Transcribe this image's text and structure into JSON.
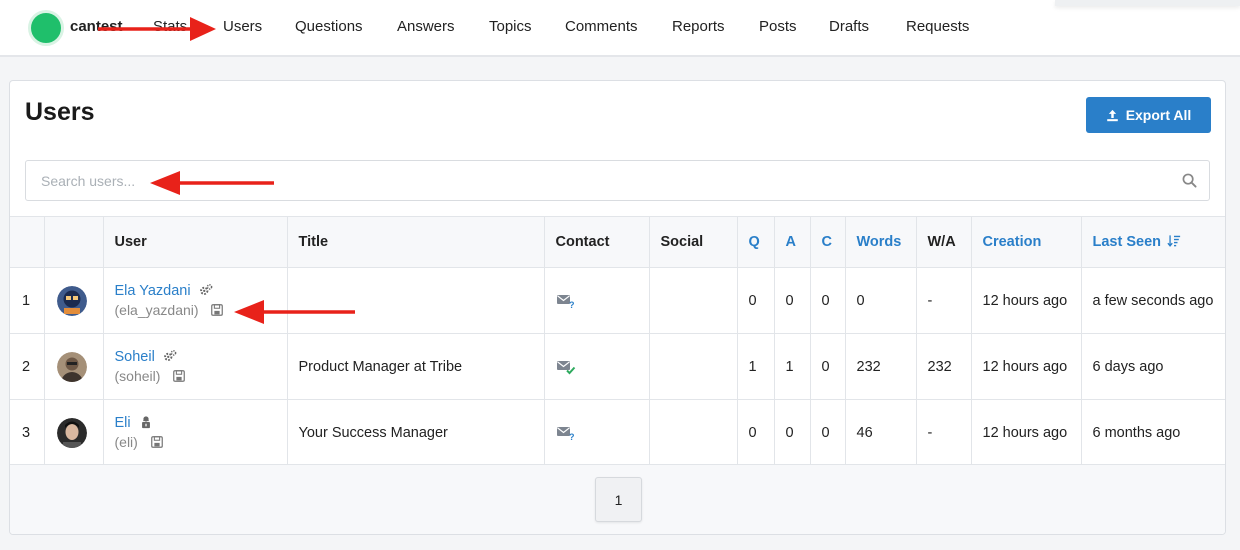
{
  "brand": {
    "name": "cantest"
  },
  "nav": [
    "Stats",
    "Users",
    "Questions",
    "Answers",
    "Topics",
    "Comments",
    "Reports",
    "Posts",
    "Drafts",
    "Requests"
  ],
  "page": {
    "title": "Users",
    "export_label": "Export All"
  },
  "search": {
    "placeholder": "Search users..."
  },
  "table": {
    "columns": [
      "",
      "",
      "User",
      "Title",
      "Contact",
      "Social",
      "Q",
      "A",
      "C",
      "Words",
      "W/A",
      "Creation",
      "Last Seen"
    ],
    "rows": [
      {
        "index": "1",
        "name": "Ela Yazdani",
        "handle": "(ela_yazdani)",
        "role_icon": "gears-icon",
        "title": "",
        "contact_icon": "mail-question-icon",
        "social": "",
        "q": "0",
        "a": "0",
        "c": "0",
        "words": "0",
        "wa": "-",
        "creation": "12 hours ago",
        "last_seen": "a few seconds ago"
      },
      {
        "index": "2",
        "name": "Soheil",
        "handle": "(soheil)",
        "role_icon": "gears-icon",
        "title": "Product Manager at Tribe",
        "contact_icon": "mail-check-icon",
        "social": "",
        "q": "1",
        "a": "1",
        "c": "0",
        "words": "232",
        "wa": "232",
        "creation": "12 hours ago",
        "last_seen": "6 days ago"
      },
      {
        "index": "3",
        "name": "Eli",
        "handle": "(eli)",
        "role_icon": "user-lock-icon",
        "title": "Your Success Manager",
        "contact_icon": "mail-question-icon",
        "social": "",
        "q": "0",
        "a": "0",
        "c": "0",
        "words": "46",
        "wa": "-",
        "creation": "12 hours ago",
        "last_seen": "6 months ago"
      }
    ]
  },
  "pagination": {
    "current": "1"
  },
  "colors": {
    "accent": "#2a7fc9",
    "annotation": "#e8221a",
    "logo": "#1fbf6b"
  }
}
